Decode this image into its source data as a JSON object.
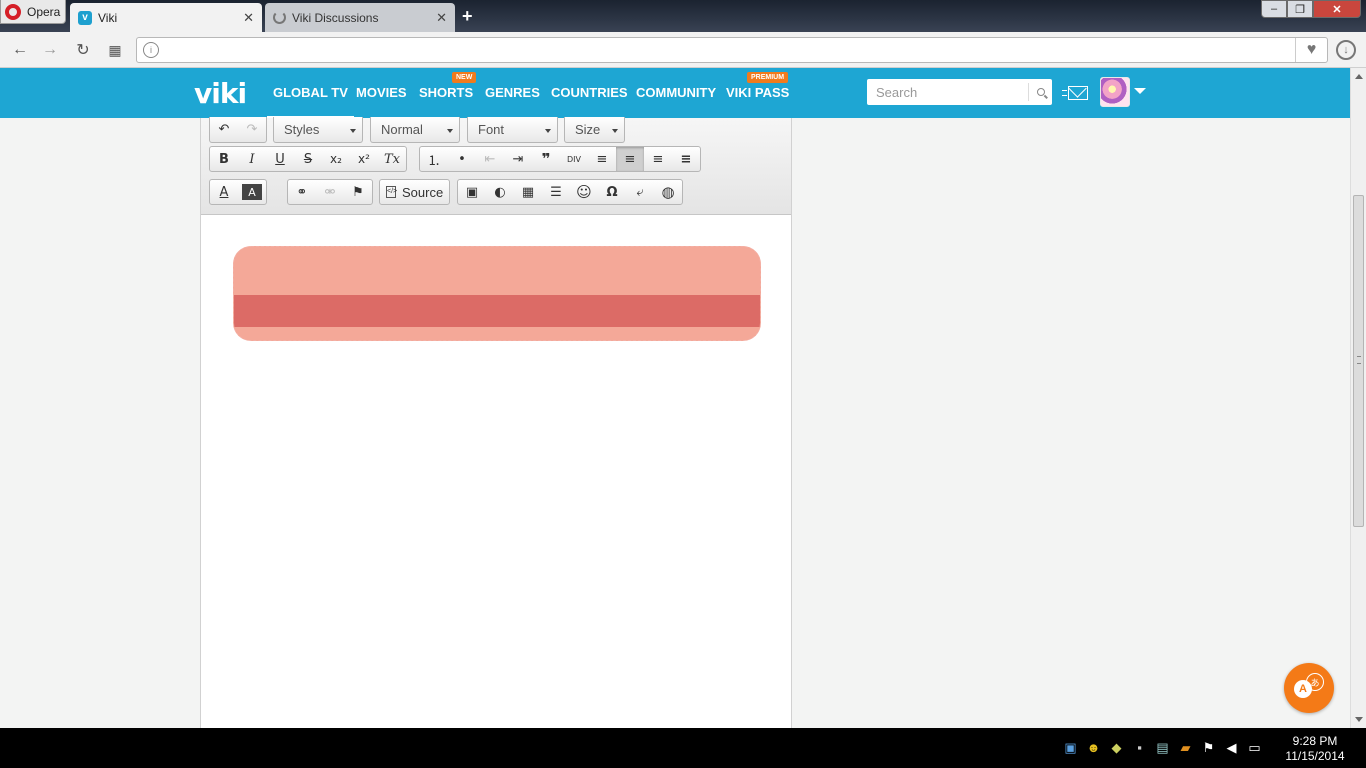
{
  "browser": {
    "menu_label": "Opera",
    "tabs": [
      {
        "label": "Viki",
        "close": "✕"
      },
      {
        "label": "Viki Discussions",
        "close": "✕"
      }
    ],
    "new_tab": "+",
    "window": {
      "minimize": "‒",
      "maximize": "❐",
      "close": "✕"
    },
    "nav": {
      "back": "←",
      "forward": "→",
      "reload": "↻",
      "speed_dial": "▦"
    },
    "address": {
      "value": "",
      "placeholder": ""
    }
  },
  "viki": {
    "logo": "viki",
    "nav": [
      {
        "label": "GLOBAL TV",
        "badge": ""
      },
      {
        "label": "MOVIES",
        "badge": ""
      },
      {
        "label": "SHORTS",
        "badge": "NEW"
      },
      {
        "label": "GENRES",
        "badge": ""
      },
      {
        "label": "COUNTRIES",
        "badge": ""
      },
      {
        "label": "COMMUNITY",
        "badge": ""
      },
      {
        "label": "VIKI PASS",
        "badge": "PREMIUM"
      }
    ],
    "search_placeholder": "Search"
  },
  "editor": {
    "combos": [
      "Styles",
      "Normal",
      "Font",
      "Size"
    ],
    "row1": {
      "undo": "↶",
      "redo": "↷"
    },
    "row2": {
      "bold": "B",
      "italic": "I",
      "underline": "U",
      "strike": "S",
      "subscript": "x₂",
      "superscript": "x²",
      "remove_format": "Tx",
      "numbered_list": "⒈",
      "bulleted_list": "•",
      "outdent": "⇤",
      "indent": "⇥",
      "blockquote": "❞",
      "div": "DIV",
      "align_left": "≡",
      "align_center": "≡",
      "align_right": "≡",
      "justify": "≡"
    },
    "row3": {
      "text_color": "A",
      "bg_color": "A",
      "link": "⚭",
      "unlink": "⚮",
      "anchor": "⚑",
      "source": "Source",
      "image": "▣",
      "flash": "◐",
      "table": "▦",
      "hr": "☰",
      "smiley": "☺",
      "special_char": "Ω",
      "page_break": "⤶",
      "iframe": "◍"
    },
    "banner_colors": {
      "top": "#f4a898",
      "stripe": "#dc6b66",
      "border": "#f3b0a6"
    }
  },
  "translate_fab": {
    "a": "A",
    "b": "あ"
  },
  "taskbar": {
    "time": "9:28 PM",
    "date": "11/15/2014"
  }
}
